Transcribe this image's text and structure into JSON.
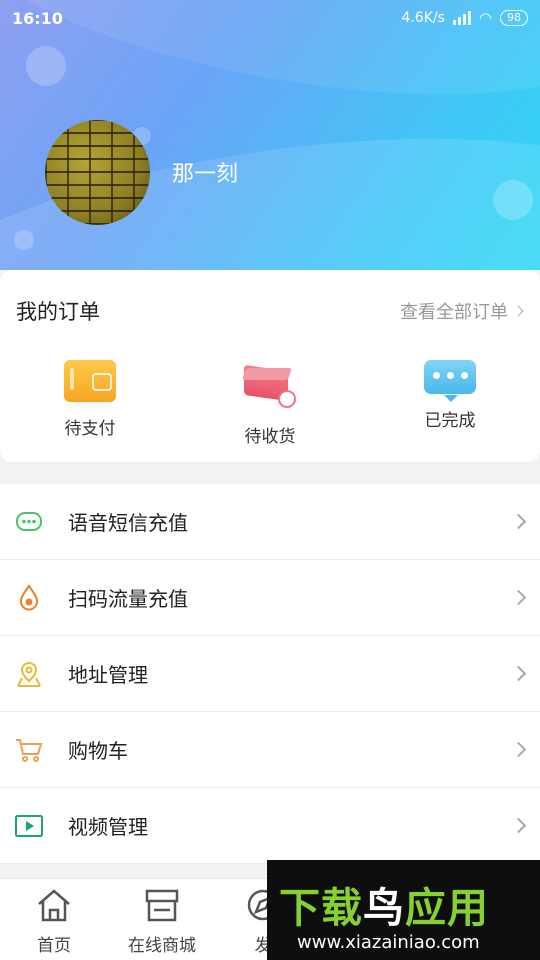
{
  "status_bar": {
    "time": "16:10",
    "speed": "4.6K/s",
    "battery": "98"
  },
  "profile": {
    "username": "那一刻"
  },
  "orders": {
    "title": "我的订单",
    "view_all": "查看全部订单",
    "items": [
      {
        "label": "待支付",
        "icon": "wallet-icon"
      },
      {
        "label": "待收货",
        "icon": "package-icon"
      },
      {
        "label": "已完成",
        "icon": "chat-bubble-icon"
      }
    ]
  },
  "menu": [
    {
      "label": "语音短信充值",
      "icon": "message-icon",
      "color": "#4cc26a"
    },
    {
      "label": "扫码流量充值",
      "icon": "drop-icon",
      "color": "#e9822e"
    },
    {
      "label": "地址管理",
      "icon": "location-icon",
      "color": "#e9b83a"
    },
    {
      "label": "购物车",
      "icon": "cart-icon",
      "color": "#e9a24e"
    },
    {
      "label": "视频管理",
      "icon": "video-icon",
      "color": "#1aa56b"
    }
  ],
  "bottom_nav": [
    {
      "label": "首页",
      "icon": "home-icon"
    },
    {
      "label": "在线商城",
      "icon": "store-icon"
    },
    {
      "label": "发",
      "icon": "discover-icon"
    }
  ],
  "watermark": {
    "logo_a": "下载",
    "logo_b": "鸟",
    "logo_c": "应用",
    "url": "www.xiazainiao.com"
  }
}
